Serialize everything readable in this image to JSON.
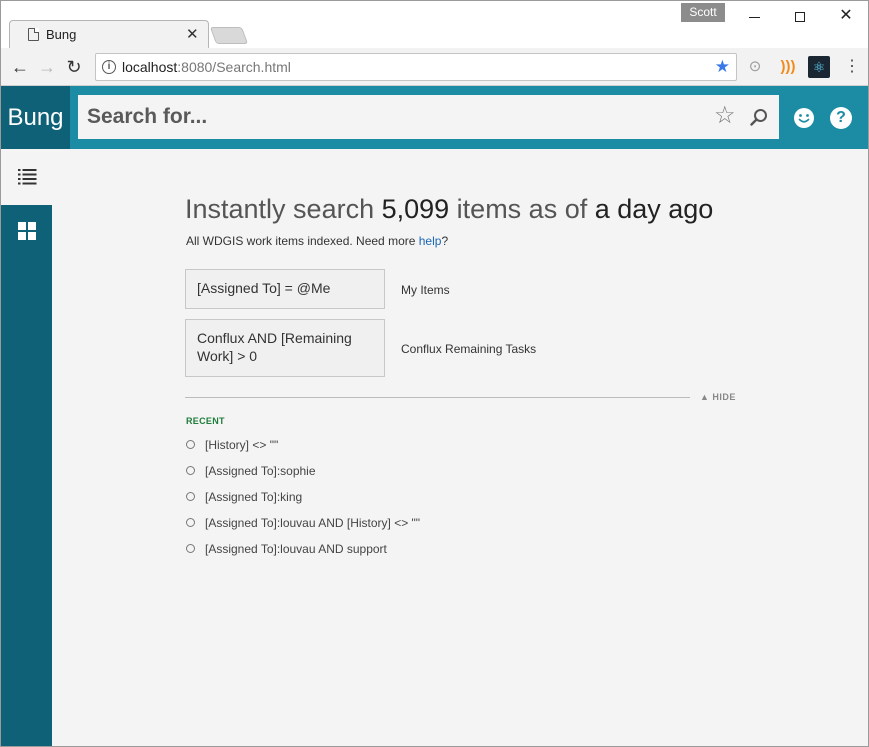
{
  "browser": {
    "tab_title": "Bung",
    "tab_close": "✕",
    "profile": "Scott",
    "url_host": "localhost",
    "url_path": ":8080/Search.html"
  },
  "app": {
    "brand": "Bung",
    "search_placeholder": "Search for...",
    "help_label": "?"
  },
  "main": {
    "headline_prefix": "Instantly search ",
    "item_count": "5,099",
    "headline_mid": " items as of ",
    "age": "a day ago",
    "subline_prefix": "All WDGIS work items indexed. Need more ",
    "help_link": "help",
    "subline_suffix": "?",
    "saved_queries": [
      {
        "query": "[Assigned To] = @Me",
        "label": "My Items"
      },
      {
        "query": "Conflux AND [Remaining Work] > 0",
        "label": "Conflux Remaining Tasks"
      }
    ],
    "hide_label": "▲ HIDE",
    "recent_title": "RECENT",
    "recent": [
      "[History] <> \"\"",
      "[Assigned To]:sophie",
      "[Assigned To]:king",
      "[Assigned To]:louvau AND [History] <> \"\"",
      "[Assigned To]:louvau AND support"
    ]
  },
  "colors": {
    "brand_dark": "#0e6177",
    "brand": "#1b8ca4",
    "recent_title": "#1e7d3a",
    "link": "#1a66b3"
  }
}
